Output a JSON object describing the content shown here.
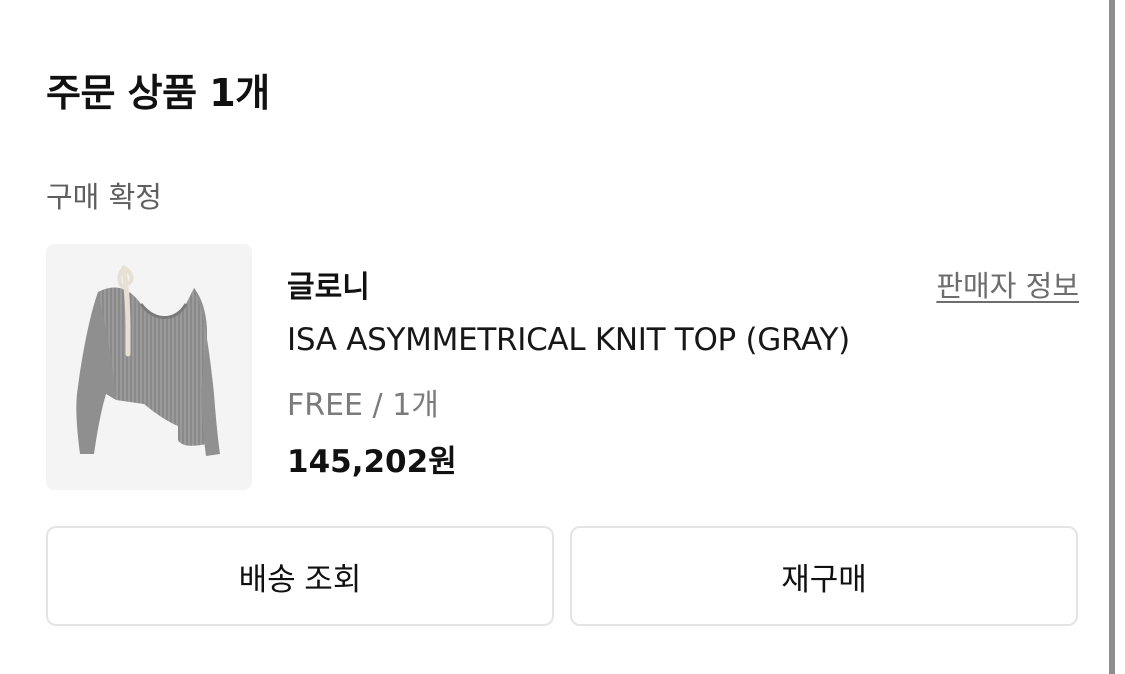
{
  "order": {
    "title": "주문 상품 1개",
    "status": "구매 확정"
  },
  "product": {
    "brand": "글로니",
    "seller_link": "판매자 정보",
    "name": "ISA ASYMMETRICAL KNIT TOP (GRAY)",
    "option": "FREE / 1개",
    "price": "145,202원",
    "image_icon": "gray-knit-top-photo"
  },
  "actions": {
    "track_delivery": "배송 조회",
    "rebuy": "재구매"
  }
}
